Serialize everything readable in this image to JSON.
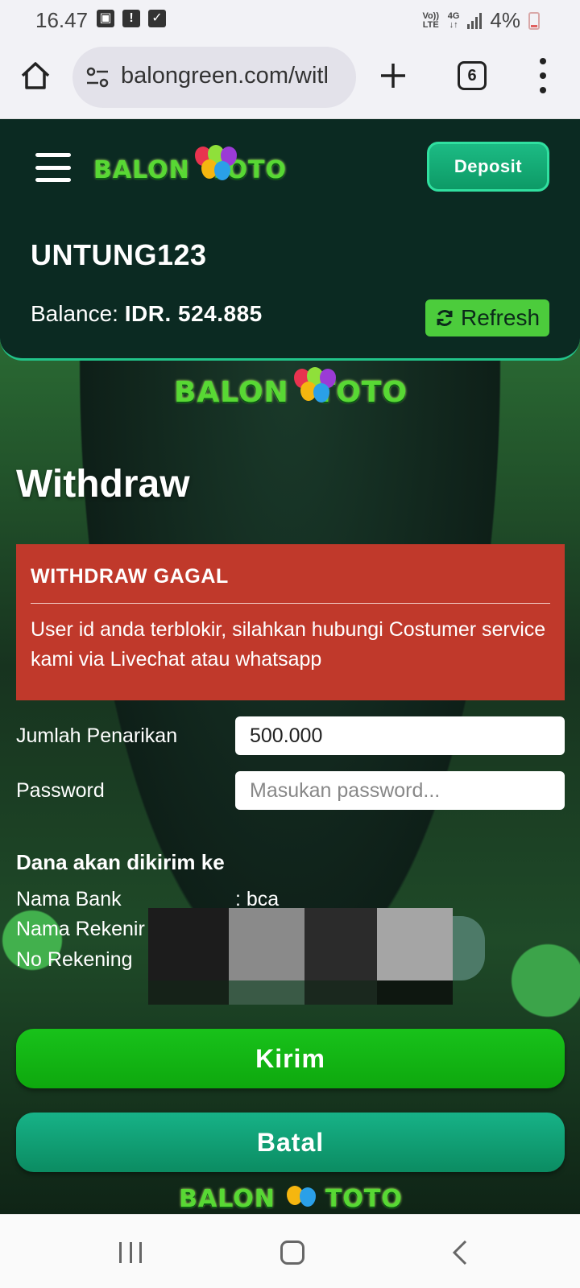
{
  "status_bar": {
    "time": "16.47",
    "network_top": "Vo)) LTE",
    "network_type": "4G",
    "battery": "4%"
  },
  "browser": {
    "url": "balongreen.com/witl",
    "tab_count": "6",
    "icons": [
      "home-icon",
      "site-settings-icon",
      "new-tab-plus-icon",
      "tab-switcher-icon",
      "more-menu-icon"
    ]
  },
  "header": {
    "logo_text_left": "BALON",
    "logo_text_right": "TOTO",
    "deposit_label": "Deposit",
    "username": "UNTUNG123",
    "balance_label": "Balance:",
    "balance_value": "IDR. 524.885",
    "refresh_label": "Refresh"
  },
  "page": {
    "title": "Withdraw"
  },
  "alert": {
    "title": "WITHDRAW GAGAL",
    "message": "User id anda terblokir, silahkan hubungi Costumer service kami via Livechat atau whatsapp",
    "color": "#c0392b"
  },
  "form": {
    "amount_label": "Jumlah Penarikan",
    "amount_value": "500.000",
    "password_label": "Password",
    "password_placeholder": "Masukan password..."
  },
  "destination": {
    "title": "Dana akan dikirim ke",
    "bank_label": "Nama Bank",
    "bank_value": ": bca",
    "account_name_label": "Nama Rekenir",
    "account_number_label": "No Rekening"
  },
  "actions": {
    "submit_label": "Kirim",
    "cancel_label": "Batal"
  },
  "colors": {
    "header_bg": "#0b2a22",
    "accent_green": "#1cbb84",
    "refresh_green": "#4ccc3c",
    "submit_green": "#18c21a",
    "cancel_teal": "#17b287"
  }
}
